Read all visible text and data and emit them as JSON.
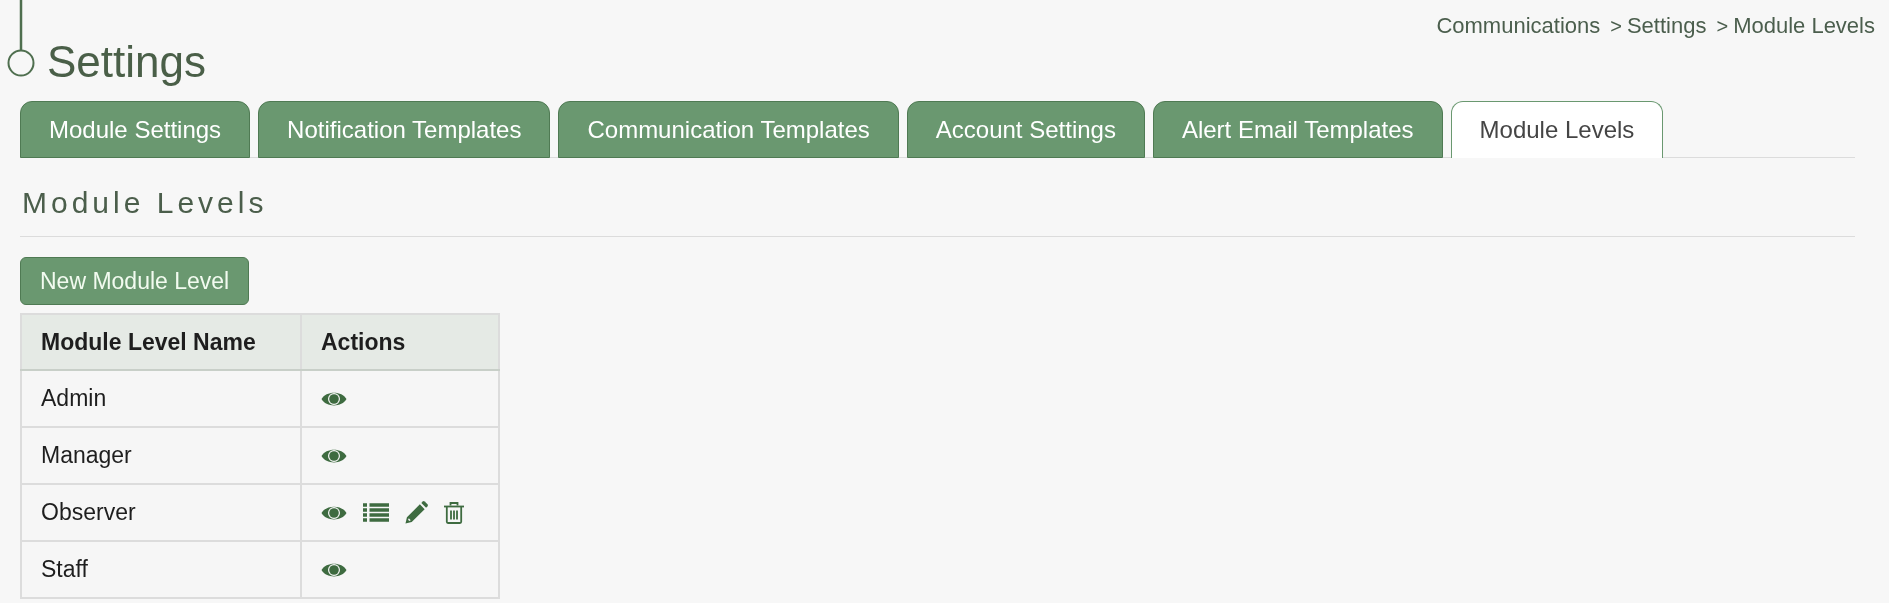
{
  "page": {
    "title": "Settings"
  },
  "breadcrumb": [
    {
      "label": "Communications"
    },
    {
      "separator": ">",
      "label": "Settings"
    },
    {
      "separator": ">",
      "label": "Module Levels"
    }
  ],
  "tabs": [
    {
      "label": "Module Settings",
      "selected": false
    },
    {
      "label": "Notification Templates",
      "selected": false
    },
    {
      "label": "Communication Templates",
      "selected": false
    },
    {
      "label": "Account Settings",
      "selected": false
    },
    {
      "label": "Alert Email Templates",
      "selected": false
    },
    {
      "label": "Module Levels",
      "selected": true
    }
  ],
  "section": {
    "heading": "Module Levels",
    "new_button": "New Module Level"
  },
  "table": {
    "columns": [
      "Module Level Name",
      "Actions"
    ],
    "rows": [
      {
        "name": "Admin",
        "actions": [
          {
            "kind": "view"
          }
        ]
      },
      {
        "name": "Manager",
        "actions": [
          {
            "kind": "view"
          }
        ]
      },
      {
        "name": "Observer",
        "actions": [
          {
            "kind": "view"
          },
          {
            "kind": "list"
          },
          {
            "kind": "edit"
          },
          {
            "kind": "delete"
          }
        ]
      },
      {
        "name": "Staff",
        "actions": [
          {
            "kind": "view"
          }
        ]
      }
    ]
  }
}
